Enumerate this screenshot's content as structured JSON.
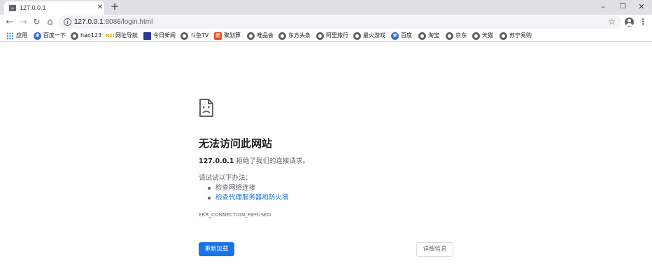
{
  "browser": {
    "tab": {
      "title": "127.0.0.1",
      "favicon": "page-favicon"
    },
    "new_tab": "+",
    "window_controls": {
      "minimize": "–",
      "maximize": "❐",
      "close": "✕"
    },
    "nav": {
      "back": "←",
      "forward": "→",
      "reload": "↻",
      "home": "⌂"
    },
    "omnibox": {
      "host": "127.0.0.1",
      "path": ":8086/login.html",
      "info_icon": "i",
      "star_icon": "☆"
    },
    "menu": "⋮"
  },
  "bookmarks": [
    {
      "label": "应用",
      "icon": "apps-grid-icon"
    },
    {
      "label": "百度一下",
      "icon": "baidu-paw-icon"
    },
    {
      "label": "hao123",
      "icon": "globe-icon"
    },
    {
      "label": "网址导航",
      "icon": "wangzhi-icon",
      "icon_text": "NGI"
    },
    {
      "label": "今日新闻",
      "icon": "news-icon"
    },
    {
      "label": "斗鱼TV",
      "icon": "globe-icon"
    },
    {
      "label": "聚划算",
      "icon": "juhuasuan-icon"
    },
    {
      "label": "唯品会",
      "icon": "globe-icon"
    },
    {
      "label": "东方头条",
      "icon": "globe-icon"
    },
    {
      "label": "阿里旅行",
      "icon": "globe-icon"
    },
    {
      "label": "最火游戏",
      "icon": "globe-icon"
    },
    {
      "label": "百度",
      "icon": "baidu-paw-icon"
    },
    {
      "label": "淘宝",
      "icon": "globe-icon"
    },
    {
      "label": "京东",
      "icon": "globe-icon"
    },
    {
      "label": "天猫",
      "icon": "globe-icon"
    },
    {
      "label": "苏宁易购",
      "icon": "globe-icon"
    }
  ],
  "error": {
    "icon": "sad-page-icon",
    "title": "无法访问此网站",
    "host": "127.0.0.1",
    "message": " 拒绝了我们的连接请求。",
    "try_label": "请试试以下办法：",
    "suggestions": [
      "检查网络连接",
      "检查代理服务器和防火墙"
    ],
    "code": "ERR_CONNECTION_REFUSED",
    "reload_button": "重新加载",
    "details_button": "详细信息"
  },
  "colors": {
    "tabstrip": "#dee1e6",
    "link": "#1a73e8",
    "button_primary": "#1a73e8",
    "text_secondary": "#5f6368"
  }
}
